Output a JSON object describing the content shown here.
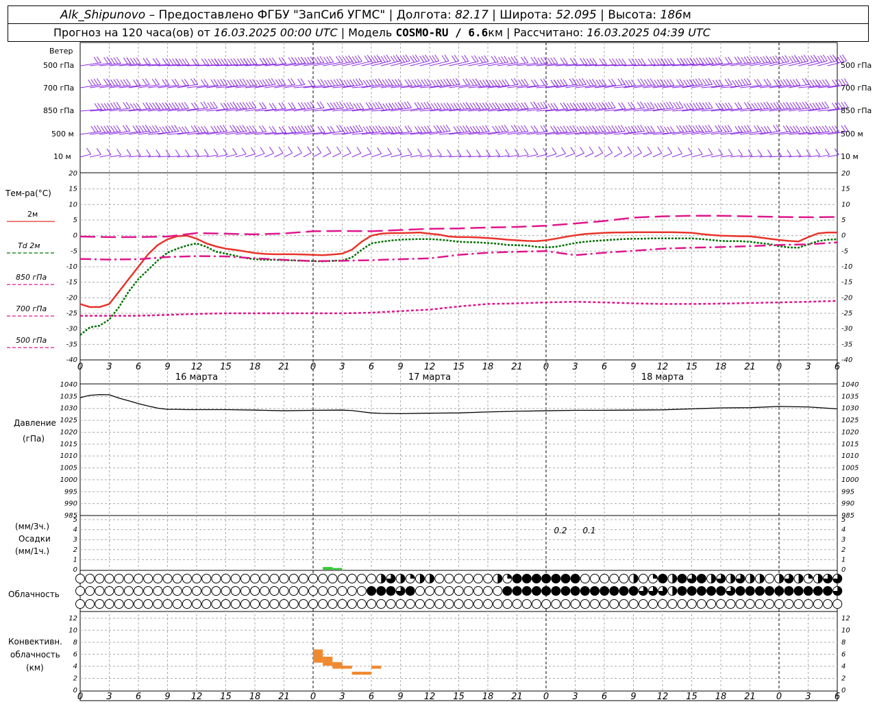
{
  "header": {
    "station": "Alk_Shipunovo",
    "provider": "– Предоставлено ФГБУ \"ЗапСиб УГМС\" |",
    "lon_label": "Долгота:",
    "lon": "82.17",
    "lat_label": "| Широта:",
    "lat": "52.095",
    "alt_label": "| Высота:",
    "alt": "186",
    "alt_unit": "м",
    "forecast_prefix": "Прогноз на 120 часа(ов) от",
    "forecast_from": "16.03.2025 00:00 UTC",
    "model_label": "| Модель",
    "model": "COSMO-RU / 6.6",
    "model_unit": "км",
    "calc_label": "| Рассчитано:",
    "calc": "16.03.2025 04:39 UTC"
  },
  "labels": {
    "wind": "Ветер",
    "levels": [
      "500 гПа",
      "700 гПа",
      "850 гПа",
      "500 м",
      "10  м"
    ],
    "temp": "Тем-ра(°С)",
    "temp_legend": [
      "2м",
      "Td  2м",
      "850 гПа",
      "700 гПа",
      "500 гПа"
    ],
    "pressure": [
      "Давление",
      "(гПа)"
    ],
    "precip": [
      "(мм/3ч.)",
      "Осадки",
      "(мм/1ч.)"
    ],
    "cloud": "Облачность",
    "conv": [
      "Конвективн.",
      "облачность",
      "(км)"
    ],
    "days": [
      "16 марта",
      "17 марта",
      "18 марта"
    ],
    "precip_values": [
      "0.2",
      "0.1"
    ]
  },
  "colors": {
    "t2m": "#e8332a",
    "td2m": "#007000",
    "t850": "#e0148c",
    "t700": "#e0148c",
    "t500": "#e0148c",
    "wind": "#8a2be2",
    "precip": "#33cc33",
    "conv": "#f08a30",
    "grid": "#aaaaaa"
  },
  "chart_data": [
    {
      "type": "line",
      "panel": "temperature",
      "ylabel": "Тем-ра(°С)",
      "ylim": [
        -40,
        20
      ],
      "yticks": [
        -40,
        -35,
        -30,
        -25,
        -20,
        -15,
        -10,
        -5,
        0,
        5,
        10,
        15,
        20
      ],
      "x_hours": [
        0,
        3,
        6,
        9,
        12,
        15,
        18,
        21,
        24,
        27,
        30,
        33,
        36,
        39,
        42,
        45,
        48,
        51,
        54,
        57,
        60,
        63,
        66,
        69,
        72,
        75,
        78
      ],
      "xtick_labels": [
        "0",
        "3",
        "6",
        "9",
        "12",
        "15",
        "18",
        "21",
        "0",
        "3",
        "6",
        "9",
        "12",
        "15",
        "18",
        "21",
        "0",
        "3",
        "6",
        "9",
        "12",
        "15",
        "18",
        "21",
        "0",
        "3",
        "6"
      ],
      "series": [
        {
          "name": "2м",
          "x": [
            0,
            1,
            2,
            3,
            4,
            5,
            6,
            7,
            8,
            9,
            10,
            11,
            12,
            13,
            14,
            15,
            16,
            17,
            18,
            19,
            20,
            21,
            22,
            23,
            24,
            25,
            26,
            27,
            28,
            29,
            30,
            31,
            32,
            33,
            34,
            35,
            36,
            37,
            38,
            39,
            40,
            41,
            42,
            43,
            44,
            45,
            46,
            47,
            48,
            49,
            50,
            51,
            52,
            53,
            54,
            55,
            56,
            57,
            58,
            59,
            60,
            61,
            62,
            63,
            64,
            65,
            66,
            67,
            68,
            69,
            70,
            71,
            72,
            73,
            74,
            75,
            76,
            77,
            78
          ],
          "values": [
            -22,
            -23,
            -23,
            -22,
            -18,
            -14,
            -10,
            -6,
            -3,
            -1.2,
            -0.2,
            0,
            -1,
            -2.5,
            -3.5,
            -4.2,
            -4.6,
            -5.1,
            -5.6,
            -5.9,
            -6,
            -6,
            -6,
            -6.1,
            -6.2,
            -6.3,
            -6.1,
            -5.8,
            -4.5,
            -2,
            0,
            0.6,
            0.8,
            0.8,
            0.9,
            1,
            0.6,
            0.3,
            -0.3,
            -0.5,
            -0.5,
            -0.6,
            -0.8,
            -1,
            -1.3,
            -1.5,
            -1.7,
            -1.8,
            -1.5,
            -1,
            -0.4,
            0.1,
            0.5,
            0.7,
            0.9,
            1,
            1,
            1.1,
            1.1,
            1.1,
            1.1,
            1.1,
            1,
            0.9,
            0.5,
            0.2,
            0,
            -0.1,
            -0.2,
            -0.2,
            -0.6,
            -1,
            -1.4,
            -1.7,
            -1.9,
            -0.5,
            0.7,
            1,
            1
          ]
        },
        {
          "name": "Td  2м",
          "x": [
            0,
            1,
            2,
            3,
            4,
            5,
            6,
            7,
            8,
            9,
            10,
            11,
            12,
            13,
            14,
            15,
            16,
            17,
            18,
            19,
            20,
            21,
            22,
            23,
            24,
            25,
            26,
            27,
            28,
            29,
            30,
            31,
            32,
            33,
            34,
            35,
            36,
            37,
            38,
            39,
            40,
            41,
            42,
            43,
            44,
            45,
            46,
            47,
            48,
            49,
            50,
            51,
            52,
            53,
            54,
            55,
            56,
            57,
            58,
            59,
            60,
            61,
            62,
            63,
            64,
            65,
            66,
            67,
            68,
            69,
            70,
            71,
            72,
            73,
            74,
            75,
            76,
            77,
            78
          ],
          "values": [
            -32,
            -29.5,
            -29,
            -27,
            -23,
            -18,
            -14,
            -11,
            -8,
            -5.5,
            -4.2,
            -3.2,
            -2.5,
            -3.6,
            -5.2,
            -5.8,
            -6.5,
            -7.2,
            -7.6,
            -7.8,
            -7.8,
            -7.9,
            -8,
            -8.1,
            -8.2,
            -8.3,
            -8.1,
            -8,
            -7,
            -4.6,
            -2.5,
            -2,
            -1.6,
            -1.3,
            -1.2,
            -1.1,
            -1.1,
            -1.3,
            -1.6,
            -2,
            -2.1,
            -2.2,
            -2.4,
            -2.6,
            -3,
            -3.1,
            -3.2,
            -3.6,
            -3.8,
            -3.6,
            -3,
            -2.4,
            -2,
            -1.7,
            -1.5,
            -1.3,
            -1.1,
            -1,
            -1,
            -0.9,
            -0.9,
            -0.9,
            -0.9,
            -0.9,
            -1.1,
            -1.4,
            -1.7,
            -1.8,
            -1.8,
            -2,
            -2.4,
            -2.7,
            -3.4,
            -3.8,
            -3.9,
            -2.8,
            -1.8,
            -1.3,
            -1.2
          ]
        },
        {
          "name": "850 гПа",
          "x": [
            0,
            3,
            6,
            9,
            12,
            15,
            18,
            21,
            24,
            27,
            30,
            33,
            36,
            39,
            42,
            45,
            48,
            51,
            54,
            57,
            60,
            63,
            66,
            69,
            72,
            75,
            78
          ],
          "values": [
            -0.3,
            -0.5,
            -0.5,
            -0.3,
            0.8,
            0.6,
            0.4,
            0.7,
            1.4,
            1.5,
            1.4,
            1.8,
            2.2,
            2.3,
            2.6,
            2.8,
            3.2,
            3.9,
            4.7,
            5.8,
            6.2,
            6.4,
            6.4,
            6.2,
            6,
            5.9,
            6
          ]
        },
        {
          "name": "700 гПа",
          "x": [
            0,
            3,
            6,
            9,
            12,
            15,
            18,
            21,
            24,
            27,
            30,
            33,
            36,
            39,
            42,
            45,
            48,
            51,
            54,
            57,
            60,
            63,
            66,
            69,
            72,
            75,
            78
          ],
          "values": [
            -7.5,
            -7.7,
            -7.6,
            -6.9,
            -6.6,
            -6.7,
            -7.3,
            -7.8,
            -8.2,
            -8.1,
            -7.9,
            -7.6,
            -7.3,
            -6.2,
            -5.5,
            -5.2,
            -5,
            -6.3,
            -5.5,
            -4.9,
            -4.2,
            -3.9,
            -3.7,
            -3.4,
            -3,
            -2.8,
            -2.2
          ]
        },
        {
          "name": "500 гПа",
          "x": [
            0,
            3,
            6,
            9,
            12,
            15,
            18,
            21,
            24,
            27,
            30,
            33,
            36,
            39,
            42,
            45,
            48,
            51,
            54,
            57,
            60,
            63,
            66,
            69,
            72,
            75,
            78
          ],
          "values": [
            -25.8,
            -25.8,
            -25.8,
            -25.5,
            -25.2,
            -25,
            -25,
            -25,
            -25,
            -25,
            -24.8,
            -24.3,
            -23.8,
            -22.8,
            -22,
            -21.8,
            -21.5,
            -21.3,
            -21.5,
            -21.8,
            -22,
            -22,
            -21.9,
            -21.7,
            -21.5,
            -21.3,
            -21
          ]
        }
      ]
    },
    {
      "type": "line",
      "panel": "pressure",
      "ylabel": "Давление (гПа)",
      "ylim": [
        985,
        1040
      ],
      "yticks": [
        985,
        990,
        995,
        1000,
        1005,
        1010,
        1015,
        1020,
        1025,
        1030,
        1035,
        1040
      ],
      "series": [
        {
          "name": "Давление",
          "x": [
            0,
            1,
            2,
            3,
            4,
            5,
            6,
            7,
            8,
            9,
            10,
            11,
            12,
            15,
            18,
            21,
            24,
            27,
            28,
            29,
            30,
            31,
            33,
            36,
            39,
            42,
            45,
            48,
            51,
            54,
            57,
            60,
            63,
            66,
            69,
            72,
            75,
            78
          ],
          "values": [
            1034.5,
            1035.5,
            1035.8,
            1035.7,
            1034.3,
            1033.2,
            1032,
            1031,
            1030.1,
            1029.6,
            1029.6,
            1029.5,
            1029.5,
            1029.5,
            1029.3,
            1029,
            1029.2,
            1029.3,
            1029.1,
            1028.6,
            1028.1,
            1027.9,
            1027.8,
            1028,
            1028.1,
            1028.5,
            1028.8,
            1029,
            1029.2,
            1029.2,
            1029.3,
            1029.4,
            1029.8,
            1030.2,
            1030.3,
            1030.8,
            1030.6,
            1029.8
          ]
        }
      ]
    },
    {
      "type": "bar",
      "panel": "precipitation",
      "ylabel": "Осадки",
      "ylim": [
        0,
        5
      ],
      "yticks": [
        0,
        1,
        2,
        3,
        4,
        5
      ],
      "bars": [
        {
          "x0": 25,
          "x1": 26,
          "value": 0.2
        },
        {
          "x0": 26,
          "x1": 27,
          "value": 0.1
        }
      ],
      "annotations": [
        "0.2",
        "0.1"
      ]
    },
    {
      "type": "table",
      "panel": "cloudiness",
      "ylabel": "Облачность",
      "layers": [
        "upper",
        "middle",
        "lower"
      ],
      "x_hours": [
        0,
        1,
        2,
        3,
        4,
        5,
        6,
        7,
        8,
        9,
        10,
        11,
        12,
        13,
        14,
        15,
        16,
        17,
        18,
        19,
        20,
        21,
        22,
        23,
        24,
        25,
        26,
        27,
        28,
        29,
        30,
        31,
        32,
        33,
        34,
        35,
        36,
        37,
        38,
        39,
        40,
        41,
        42,
        43,
        44,
        45,
        46,
        47,
        48,
        49,
        50,
        51,
        52,
        53,
        54,
        55,
        56,
        57,
        58,
        59,
        60,
        61,
        62,
        63,
        64,
        65,
        66,
        67,
        68,
        69,
        70,
        71,
        72,
        73,
        74,
        75,
        76,
        77,
        78
      ],
      "upper": [
        0,
        0,
        0,
        0,
        0,
        0,
        0,
        0,
        0,
        0,
        0,
        0,
        0,
        0,
        0,
        0,
        0,
        0,
        0,
        0,
        0,
        0,
        0,
        0,
        0,
        0,
        0,
        0,
        0,
        0,
        0,
        0,
        0,
        0,
        0,
        0,
        0,
        0.5,
        0.25,
        0.75,
        0.5,
        0.25,
        0.5,
        0.5,
        0,
        0,
        0,
        0,
        0,
        0,
        0,
        0,
        0.5,
        0.25,
        1,
        1,
        1,
        1,
        1,
        1,
        1,
        1,
        0,
        0,
        0,
        0,
        0,
        0,
        0.75,
        0.5,
        0,
        0.25,
        1,
        0,
        0.5,
        1,
        0.75,
        1,
        0.5,
        1,
        0.75,
        0.5,
        0.75,
        0.5,
        0.5,
        0,
        0,
        0.5,
        0.75,
        0.5,
        0.25,
        0.75,
        0.5,
        0.75,
        0.75
      ],
      "middle": [
        0,
        0,
        0,
        0,
        0,
        0,
        0,
        0,
        0,
        0,
        0,
        0,
        0,
        0,
        0,
        0,
        0,
        0,
        0,
        0,
        0,
        0,
        0,
        0,
        0,
        0,
        0,
        0,
        0,
        0,
        0,
        0,
        0,
        0,
        0,
        0,
        0,
        1,
        1,
        1,
        0.75,
        1,
        0.75,
        0,
        0,
        0,
        0,
        0,
        0,
        0,
        0,
        0,
        0,
        0,
        1,
        1,
        1,
        1,
        1,
        1,
        1,
        1,
        1,
        1,
        1,
        1,
        1,
        1,
        1,
        1,
        0.75,
        0.75,
        0.75,
        0.75,
        0.5,
        0.75,
        1,
        1,
        1,
        1,
        1,
        1,
        0.75,
        1,
        1,
        1,
        1,
        0.75,
        1,
        1,
        1,
        1,
        1,
        1,
        1,
        0.75
      ],
      "lower": [
        0,
        0,
        0,
        0,
        0,
        0,
        0,
        0,
        0,
        0,
        0,
        0,
        0,
        0,
        0,
        0,
        0,
        0,
        0,
        0,
        0,
        0,
        0,
        0,
        0,
        0,
        0,
        0,
        0,
        0,
        0,
        0,
        0,
        0,
        0,
        0,
        0,
        0,
        0,
        0,
        0,
        0,
        0,
        0,
        0,
        0,
        0,
        0,
        0,
        0,
        0,
        0,
        0,
        0,
        0,
        0,
        0,
        0,
        0,
        0,
        0,
        0,
        0,
        0,
        0,
        0,
        0,
        0,
        0,
        0,
        0,
        0,
        0,
        0,
        0,
        0,
        0,
        0,
        0,
        0,
        0,
        0,
        0,
        0,
        0,
        0,
        0,
        0,
        0,
        0,
        0,
        0,
        0,
        0,
        0
      ]
    },
    {
      "type": "bar",
      "panel": "convective_cloud",
      "ylabel": "Конвективн. облачность (км)",
      "ylim": [
        0,
        13
      ],
      "yticks": [
        0,
        2,
        4,
        6,
        8,
        10,
        12
      ],
      "bars": [
        {
          "x0": 24,
          "x1": 25,
          "base": 4.6,
          "top": 6.8
        },
        {
          "x0": 25,
          "x1": 26,
          "base": 4.1,
          "top": 5.6
        },
        {
          "x0": 26,
          "x1": 27,
          "base": 3.6,
          "top": 4.7
        },
        {
          "x0": 27,
          "x1": 28,
          "base": 3.6,
          "top": 4.1
        },
        {
          "x0": 28,
          "x1": 29,
          "base": 2.6,
          "top": 3.1
        },
        {
          "x0": 29,
          "x1": 30,
          "base": 2.6,
          "top": 3.1
        },
        {
          "x0": 30,
          "x1": 31,
          "base": 3.6,
          "top": 4.1
        }
      ]
    },
    {
      "type": "scatter",
      "panel": "wind_barbs",
      "ylabel": "Ветер",
      "levels": [
        "500 гПа",
        "700 гПа",
        "850 гПа",
        "500 м",
        "10  м"
      ],
      "note": "wind barbs every hour at 5 levels"
    }
  ]
}
